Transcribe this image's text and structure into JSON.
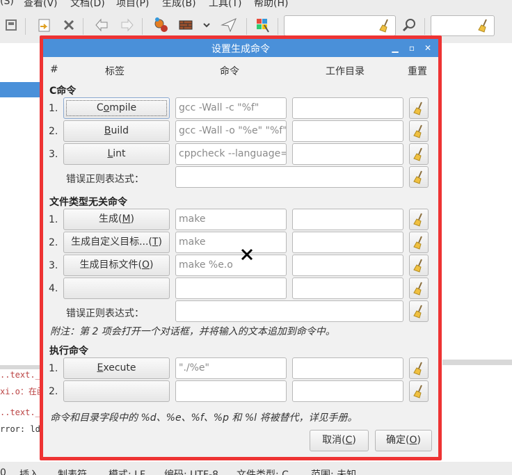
{
  "menubar": [
    "(S)",
    "查看(V)",
    "文档(D)",
    "项目(P)",
    "生成(B)",
    "工具(T)",
    "帮助(H)"
  ],
  "toolbar": {
    "icons": [
      "revert-icon",
      "open-file-icon",
      "close-icon",
      "back-icon",
      "forward-icon",
      "compile-icon",
      "build-icon",
      "dropdown-icon",
      "run-icon",
      "color-icon",
      "search-icon",
      "broom-icon"
    ]
  },
  "editor_messages": [
    "..text._Z",
    "xi.o：在函",
    "..text._Z",
    "rror: ld"
  ],
  "statusbar": [
    "0",
    "插入",
    "制表符",
    "模式: LF",
    "编码: UTF-8",
    "文件类型: C",
    "范围: 未知"
  ],
  "dialog": {
    "title": "设置生成命令",
    "headers": {
      "num": "#",
      "label": "标签",
      "command": "命令",
      "workdir": "工作目录",
      "reset": "重置"
    },
    "c_section": {
      "title": "C命令",
      "rows": [
        {
          "num": "1.",
          "label": "Compile",
          "mnemonic_index": 1,
          "command": "gcc -Wall -c \"%f\"",
          "workdir": ""
        },
        {
          "num": "2.",
          "label": "Build",
          "mnemonic_index": 0,
          "command": "gcc -Wall -o \"%e\" \"%f\"",
          "workdir": ""
        },
        {
          "num": "3.",
          "label": "Lint",
          "mnemonic_index": 0,
          "command": "cppcheck --language=",
          "workdir": ""
        }
      ],
      "error_regex_label": "错误正则表达式：",
      "error_regex": ""
    },
    "indep_section": {
      "title": "文件类型无关命令",
      "rows": [
        {
          "num": "1.",
          "label": "生成(M)",
          "command": "make",
          "workdir": ""
        },
        {
          "num": "2.",
          "label": "生成自定义目标...(T)",
          "command": "make",
          "workdir": ""
        },
        {
          "num": "3.",
          "label": "生成目标文件(O)",
          "command": "make %e.o",
          "workdir": ""
        },
        {
          "num": "4.",
          "label": "",
          "command": "",
          "workdir": ""
        }
      ],
      "error_regex_label": "错误正则表达式：",
      "error_regex": ""
    },
    "note": "附注：第 2 项会打开一个对话框，并将输入的文本追加到命令中。",
    "exec_section": {
      "title": "执行命令",
      "rows": [
        {
          "num": "1.",
          "label": "Execute",
          "command": "\"./%e\"",
          "workdir": ""
        },
        {
          "num": "2.",
          "label": "",
          "command": "",
          "workdir": ""
        }
      ]
    },
    "footer_note": "命令和目录字段中的 %d、%e、%f、%p 和 %l 将被替代，详见手册。",
    "cancel_label": "取消(C)",
    "ok_label": "确定(O)"
  },
  "colors": {
    "titlebar": "#4a90d9",
    "highlight": "#ee3333",
    "dialog_bg": "#f1f1f1"
  }
}
